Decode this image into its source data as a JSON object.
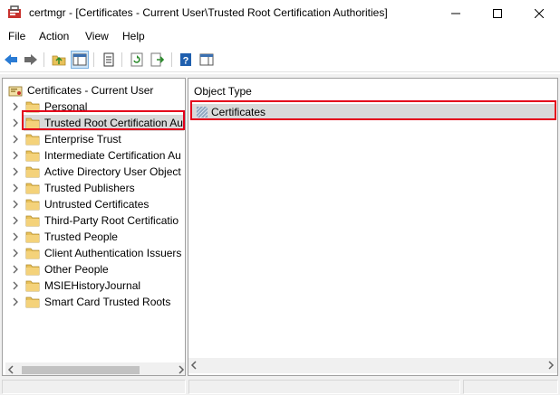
{
  "window": {
    "app_name": "certmgr",
    "title": "certmgr - [Certificates - Current User\\Trusted Root Certification Authorities]"
  },
  "menu": {
    "items": [
      "File",
      "Action",
      "View",
      "Help"
    ]
  },
  "toolbar": {
    "buttons": [
      "back-icon",
      "forward-icon",
      "up-folder-icon",
      "show-hide-tree-icon",
      "properties-icon",
      "refresh-icon",
      "export-list-icon",
      "help-icon",
      "show-hide-action-pane-icon"
    ]
  },
  "tree": {
    "root": "Certificates - Current User",
    "items": [
      "Personal",
      "Trusted Root Certification Au",
      "Enterprise Trust",
      "Intermediate Certification Au",
      "Active Directory User Object",
      "Trusted Publishers",
      "Untrusted Certificates",
      "Third-Party Root Certificatio",
      "Trusted People",
      "Client Authentication Issuers",
      "Other People",
      "MSIEHistoryJournal",
      "Smart Card Trusted Roots"
    ],
    "selected_index": 1
  },
  "list": {
    "column_header": "Object Type",
    "rows": [
      "Certificates"
    ]
  },
  "colors": {
    "highlight": "#e4001b",
    "selection": "#d9d9d9",
    "folder": "#e8c15a"
  }
}
